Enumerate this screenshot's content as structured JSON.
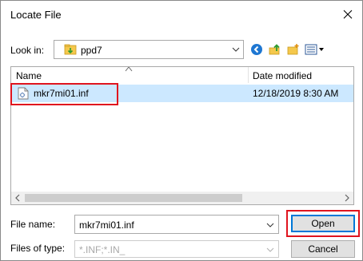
{
  "window": {
    "title": "Locate File",
    "close_glyph": "✕"
  },
  "lookin": {
    "label": "Look in:",
    "value": "ppd7",
    "icon": "folder-icon"
  },
  "toolbar": {
    "icons": [
      "back-icon",
      "up-folder-icon",
      "new-folder-icon",
      "view-menu-icon"
    ]
  },
  "list": {
    "columns": [
      "Name",
      "Date modified"
    ],
    "sort_column": "Name",
    "sort_direction": "ascending",
    "rows": [
      {
        "name": "mkr7mi01.inf",
        "date": "12/18/2019 8:30 AM",
        "selected": true
      }
    ]
  },
  "filename": {
    "label": "File name:",
    "value": "mkr7mi01.inf"
  },
  "filetype": {
    "label": "Files of type:",
    "value": "*.INF;*.IN_",
    "disabled": true
  },
  "buttons": {
    "open": "Open",
    "cancel": "Cancel"
  },
  "colors": {
    "selection": "#cce8ff",
    "highlight": "#e0141e",
    "default_button": "#0078d7"
  }
}
